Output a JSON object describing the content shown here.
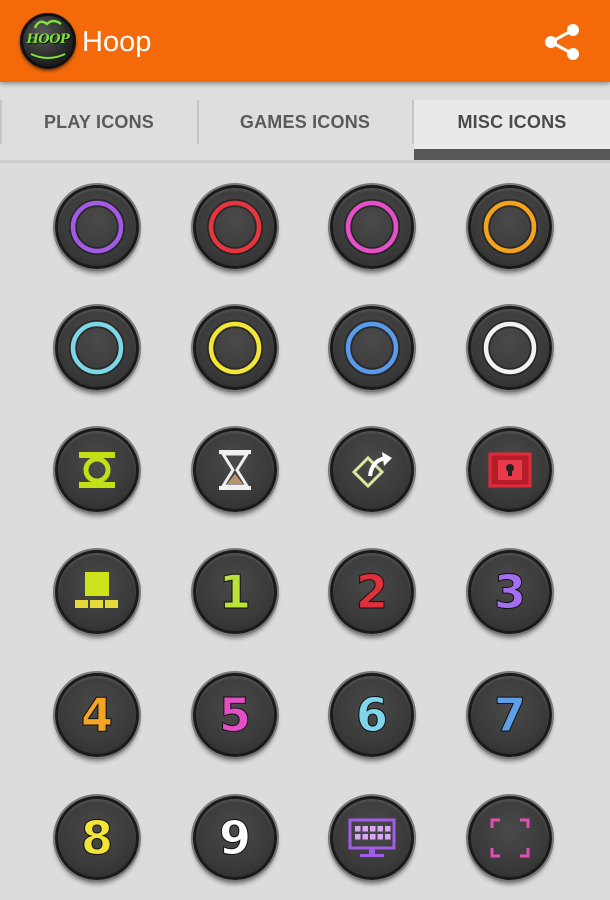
{
  "app": {
    "title": "Hoop",
    "logo_text": "HOOP",
    "logo_icon": "hoop-logo-icon",
    "share_icon": "share-icon",
    "accent": "#f46a0a"
  },
  "tabs": [
    {
      "label": "PLAY ICONS",
      "active": false
    },
    {
      "label": "GAMES ICONS",
      "active": false
    },
    {
      "label": "MISC ICONS",
      "active": true
    }
  ],
  "icons": [
    {
      "name": "ring-purple-icon",
      "type": "ring",
      "color": "#a35be6"
    },
    {
      "name": "ring-red-icon",
      "type": "ring",
      "color": "#e8343c"
    },
    {
      "name": "ring-magenta-icon",
      "type": "ring",
      "color": "#e64fc7"
    },
    {
      "name": "ring-orange-icon",
      "type": "ring",
      "color": "#f5a31a"
    },
    {
      "name": "ring-cyan-icon",
      "type": "ring",
      "color": "#7ed7e6"
    },
    {
      "name": "ring-yellow-icon",
      "type": "ring",
      "color": "#f2e636"
    },
    {
      "name": "ring-blue-icon",
      "type": "ring",
      "color": "#5a9ae8"
    },
    {
      "name": "ring-white-icon",
      "type": "ring",
      "color": "#f2f2f2"
    },
    {
      "name": "green-lantern-icon",
      "type": "lantern",
      "color": "#c3e017"
    },
    {
      "name": "hourglass-icon",
      "type": "hourglass",
      "color": "#f0f0f0"
    },
    {
      "name": "share-arrow-icon",
      "type": "sharebox",
      "color": "#d9e8a0"
    },
    {
      "name": "lock-box-icon",
      "type": "lockbox",
      "color": "#e12b3b"
    },
    {
      "name": "desktop-blocks-icon",
      "type": "blocks",
      "color": "#cde31c"
    },
    {
      "name": "digit-1-icon",
      "type": "digit",
      "text": "1",
      "color": "#b8e33a"
    },
    {
      "name": "digit-2-icon",
      "type": "digit",
      "text": "2",
      "color": "#e2303a"
    },
    {
      "name": "digit-3-icon",
      "type": "digit",
      "text": "3",
      "color": "#a36ef0"
    },
    {
      "name": "digit-4-icon",
      "type": "digit",
      "text": "4",
      "color": "#f5a524"
    },
    {
      "name": "digit-5-icon",
      "type": "digit",
      "text": "5",
      "color": "#e54fc6"
    },
    {
      "name": "digit-6-icon",
      "type": "digit",
      "text": "6",
      "color": "#7fd6ec"
    },
    {
      "name": "digit-7-icon",
      "type": "digit",
      "text": "7",
      "color": "#5f9fe8"
    },
    {
      "name": "digit-8-icon",
      "type": "digit",
      "text": "8",
      "color": "#f2e436"
    },
    {
      "name": "digit-9-icon",
      "type": "digit",
      "text": "9",
      "color": "#ffffff"
    },
    {
      "name": "monitor-keyboard-icon",
      "type": "monitor",
      "color": "#a15ce8"
    },
    {
      "name": "fullscreen-frame-icon",
      "type": "frame",
      "color": "#e24fb4"
    }
  ]
}
